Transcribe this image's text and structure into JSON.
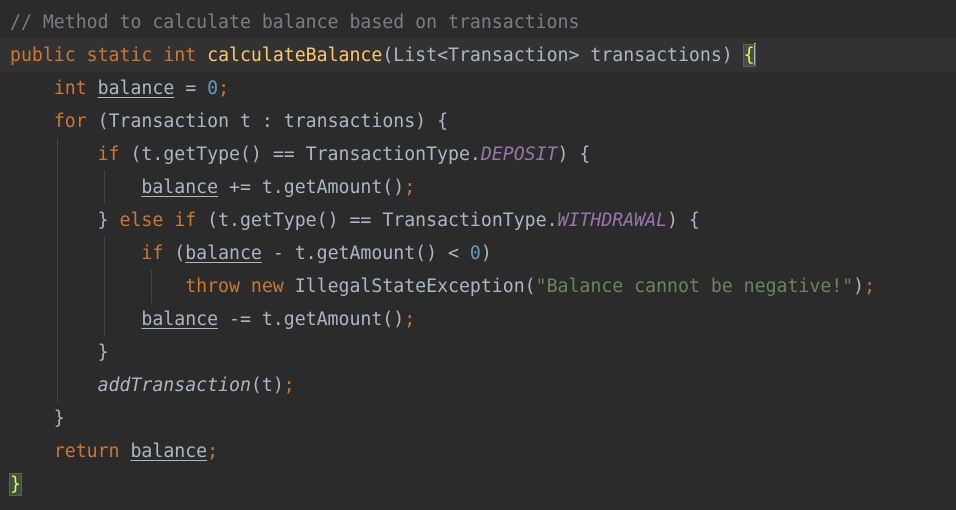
{
  "editor": {
    "lines": [
      [
        {
          "t": "// Method to calculate balance based on transactions",
          "c": "comment"
        }
      ],
      [
        {
          "t": "public",
          "c": "kw"
        },
        {
          "t": " ",
          "c": "plain"
        },
        {
          "t": "static",
          "c": "kw"
        },
        {
          "t": " ",
          "c": "plain"
        },
        {
          "t": "int",
          "c": "kw"
        },
        {
          "t": " ",
          "c": "plain"
        },
        {
          "t": "calculateBalance",
          "c": "method"
        },
        {
          "t": "(List<Transaction> transactions) ",
          "c": "plain"
        },
        {
          "t": "{",
          "c": "brace"
        }
      ],
      [
        {
          "t": "    ",
          "c": "plain"
        },
        {
          "t": "int",
          "c": "kw"
        },
        {
          "t": " ",
          "c": "plain"
        },
        {
          "t": "balance",
          "c": "var"
        },
        {
          "t": " = ",
          "c": "plain"
        },
        {
          "t": "0",
          "c": "num"
        },
        {
          "t": ";",
          "c": "punct"
        }
      ],
      [
        {
          "t": "    ",
          "c": "plain"
        },
        {
          "t": "for",
          "c": "kw"
        },
        {
          "t": " (Transaction t : transactions) {",
          "c": "plain"
        }
      ],
      [
        {
          "t": "        ",
          "c": "plain"
        },
        {
          "t": "if",
          "c": "kw"
        },
        {
          "t": " (t.getType() == TransactionType.",
          "c": "plain"
        },
        {
          "t": "DEPOSIT",
          "c": "const"
        },
        {
          "t": ") {",
          "c": "plain"
        }
      ],
      [
        {
          "t": "            ",
          "c": "plain"
        },
        {
          "t": "balance",
          "c": "var"
        },
        {
          "t": " += t.getAmount()",
          "c": "plain"
        },
        {
          "t": ";",
          "c": "punct"
        }
      ],
      [
        {
          "t": "        } ",
          "c": "plain"
        },
        {
          "t": "else",
          "c": "kw"
        },
        {
          "t": " ",
          "c": "plain"
        },
        {
          "t": "if",
          "c": "kw"
        },
        {
          "t": " (t.getType() == TransactionType.",
          "c": "plain"
        },
        {
          "t": "WITHDRAWAL",
          "c": "const"
        },
        {
          "t": ") {",
          "c": "plain"
        }
      ],
      [
        {
          "t": "            ",
          "c": "plain"
        },
        {
          "t": "if",
          "c": "kw"
        },
        {
          "t": " (",
          "c": "plain"
        },
        {
          "t": "balance",
          "c": "var"
        },
        {
          "t": " - t.getAmount() < ",
          "c": "plain"
        },
        {
          "t": "0",
          "c": "num"
        },
        {
          "t": ")",
          "c": "plain"
        }
      ],
      [
        {
          "t": "                ",
          "c": "plain"
        },
        {
          "t": "throw",
          "c": "kw"
        },
        {
          "t": " ",
          "c": "plain"
        },
        {
          "t": "new",
          "c": "kw"
        },
        {
          "t": " IllegalStateException(",
          "c": "plain"
        },
        {
          "t": "\"Balance cannot be negative!\"",
          "c": "str"
        },
        {
          "t": ")",
          "c": "plain"
        },
        {
          "t": ";",
          "c": "punct"
        }
      ],
      [
        {
          "t": "            ",
          "c": "plain"
        },
        {
          "t": "balance",
          "c": "var"
        },
        {
          "t": " -= t.getAmount()",
          "c": "plain"
        },
        {
          "t": ";",
          "c": "punct"
        }
      ],
      [
        {
          "t": "        }",
          "c": "plain"
        }
      ],
      [
        {
          "t": "        ",
          "c": "plain"
        },
        {
          "t": "addTransaction",
          "c": "italic-call"
        },
        {
          "t": "(t)",
          "c": "plain"
        },
        {
          "t": ";",
          "c": "punct"
        }
      ],
      [
        {
          "t": "    }",
          "c": "plain"
        }
      ],
      [
        {
          "t": "    ",
          "c": "plain"
        },
        {
          "t": "return",
          "c": "kw"
        },
        {
          "t": " ",
          "c": "plain"
        },
        {
          "t": "balance",
          "c": "var"
        },
        {
          "t": ";",
          "c": "punct"
        }
      ],
      [
        {
          "t": "}",
          "c": "brace"
        }
      ]
    ],
    "current_line": 1,
    "colors": {
      "background": "#2b2b2b",
      "current_line": "#323232",
      "keyword": "#cc7832",
      "method": "#ffc66d",
      "comment": "#7a7e85",
      "number": "#6897bb",
      "constant": "#9876aa",
      "string": "#6a8759",
      "text": "#a9b7c6",
      "brace_match": "#ffef28"
    }
  }
}
